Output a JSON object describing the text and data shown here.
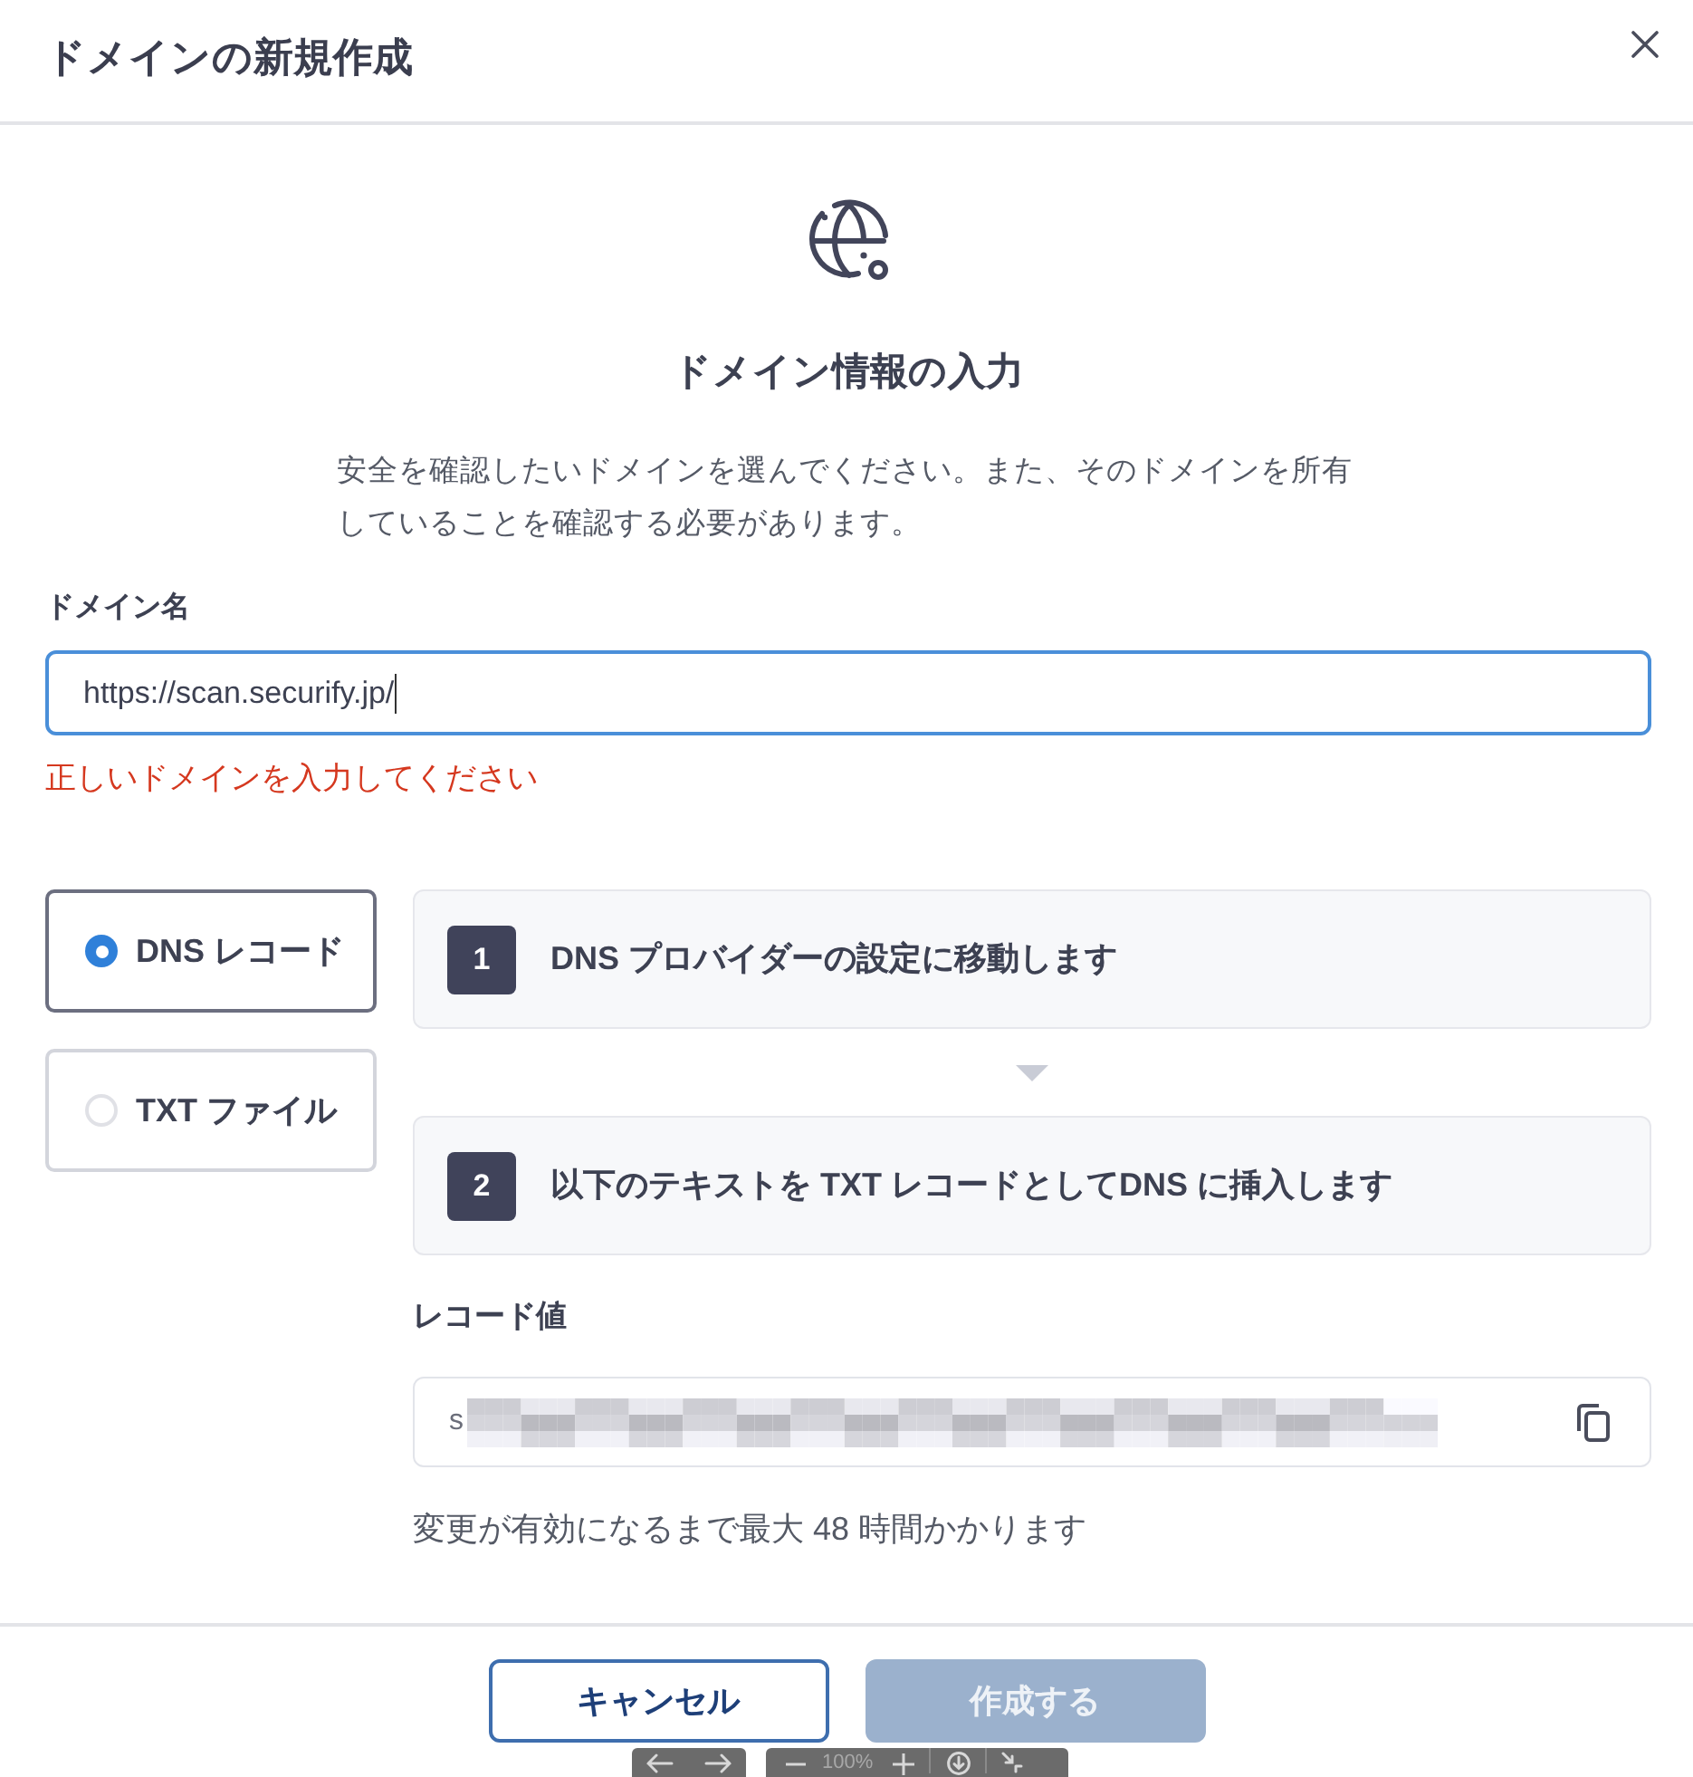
{
  "dialog": {
    "title": "ドメインの新規作成"
  },
  "intro": {
    "heading": "ドメイン情報の入力",
    "description": "安全を確認したいドメインを選んでください。また、そのドメインを所有していることを確認する必要があります。"
  },
  "domain_field": {
    "label": "ドメイン名",
    "value": "https://scan.securify.jp/",
    "focused": true,
    "error": "正しいドメインを入力してください"
  },
  "methods": [
    {
      "label": "DNS レコード",
      "selected": true
    },
    {
      "label": "TXT ファイル",
      "selected": false
    }
  ],
  "steps": [
    {
      "number": "1",
      "text": "DNS プロバイダーの設定に移動します"
    },
    {
      "number": "2",
      "text": "以下のテキストを TXT レコードとしてDNS に挿入します"
    }
  ],
  "record": {
    "label": "レコード値",
    "value": "s",
    "redacted": true
  },
  "note": "変更が有効になるまで最大 48 時間かかります",
  "footer_buttons": [
    {
      "label": "キャンセル",
      "kind": "secondary",
      "disabled": false
    },
    {
      "label": "作成する",
      "kind": "primary",
      "disabled": true
    }
  ],
  "viewer_toolbar": {
    "zoom": "100%"
  }
}
